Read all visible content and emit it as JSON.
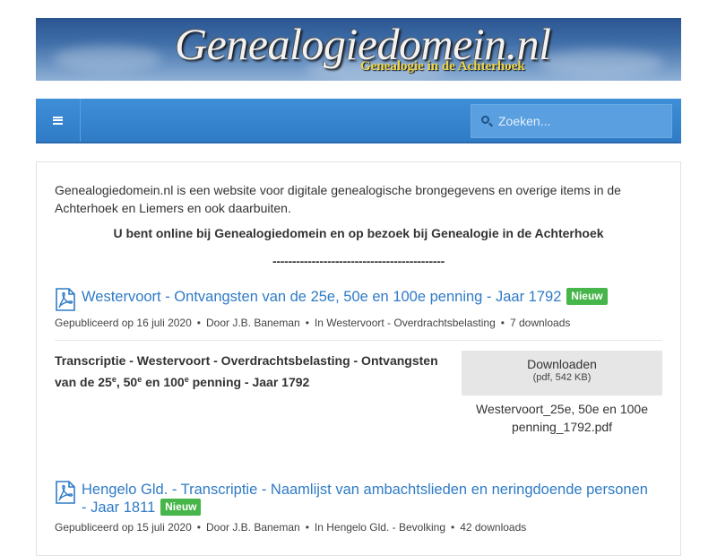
{
  "banner": {
    "title": "Genealogiedomein.nl",
    "subtitle": "Genealogie in de Achterhoek"
  },
  "navbar": {
    "menu_icon": "hamburger-icon",
    "search": {
      "placeholder": "Zoeken...",
      "icon": "search-icon"
    }
  },
  "intro": {
    "text": "Genealogiedomein.nl is een website voor digitale genealogische brongegevens en overige items in de Achterhoek en Liemers en ook daarbuiten.",
    "online_text": "U bent online bij Genealogiedomein en op bezoek bij Genealogie in de Achterhoek",
    "separator": "--------------------------------------------"
  },
  "documents": [
    {
      "title": "Westervoort - Ontvangsten van de 25e, 50e en 100e penning - Jaar 1792",
      "badge": "Nieuw",
      "meta": {
        "published": "Gepubliceerd op 16 juli 2020",
        "author": "Door J.B. Baneman",
        "category": "In Westervoort - Overdrachtsbelasting",
        "downloads": "7 downloads"
      },
      "description": {
        "part1": "Transcriptie - Westervoort - Overdrachtsbelasting - Ontvangsten van de 25",
        "sup1": "e",
        "part2": ", 50",
        "sup2": "e",
        "part3": " en 100",
        "sup3": "e",
        "part4": " penning - Jaar 1792"
      },
      "download": {
        "label": "Downloaden",
        "info": "(pdf, 542 KB)"
      },
      "filename": "Westervoort_25e, 50e en 100e penning_1792.pdf"
    },
    {
      "title": "Hengelo Gld. - Transcriptie - Naamlijst van ambachtslieden en neringdoende personen - Jaar 1811",
      "badge": "Nieuw",
      "meta": {
        "published": "Gepubliceerd op 15 juli 2020",
        "author": "Door J.B. Baneman",
        "category": "In Hengelo Gld. - Bevolking",
        "downloads": "42 downloads"
      }
    }
  ],
  "colors": {
    "navbar": "#2f7bc6",
    "link": "#2f7bc6",
    "badge": "#46b54a",
    "download_button": "#e6e6e6"
  }
}
